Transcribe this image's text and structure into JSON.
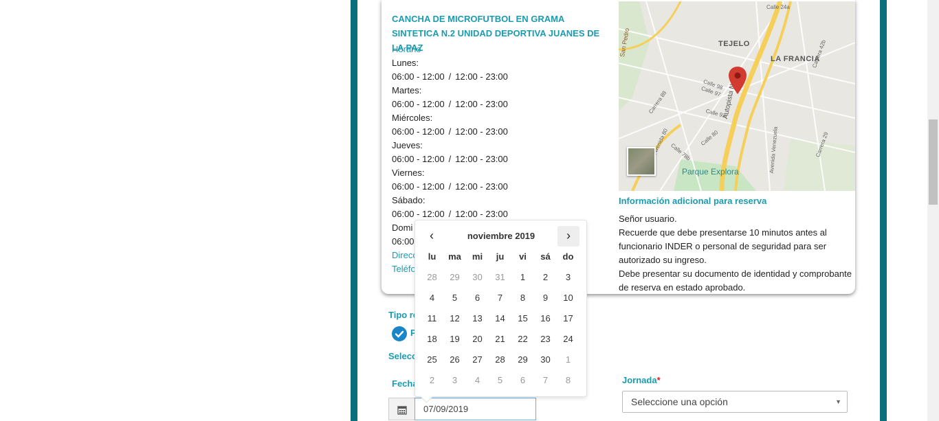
{
  "venue": {
    "title": "CANCHA DE MICROFUTBOL EN GRAMA SINTETICA N.2 UNIDAD DEPORTIVA JUANES DE LA PAZ",
    "schedule_label": "Horario",
    "schedule": [
      {
        "day": "Lunes:",
        "slot1": "06:00 - 12:00",
        "slot2": "12:00 - 23:00"
      },
      {
        "day": "Martes:",
        "slot1": "06:00 - 12:00",
        "slot2": "12:00 - 23:00"
      },
      {
        "day": "Miércoles:",
        "slot1": "06:00 - 12:00",
        "slot2": "12:00 - 23:00"
      },
      {
        "day": "Jueves:",
        "slot1": "06:00 - 12:00",
        "slot2": "12:00 - 23:00"
      },
      {
        "day": "Viernes:",
        "slot1": "06:00 - 12:00",
        "slot2": "12:00 - 23:00"
      },
      {
        "day": "Sábado:",
        "slot1": "06:00 - 12:00",
        "slot2": "12:00 - 23:00"
      },
      {
        "day": "Domi",
        "slot1": "06:00",
        "slot2": ""
      }
    ],
    "slot_separator": "/",
    "address_label": "Direcc",
    "phone_label": "Teléfo"
  },
  "map": {
    "labels": [
      "TEJELO",
      "LA FRANCIA",
      "Parque Explora",
      "Autopista Norte",
      "Calle 98",
      "Calle 97",
      "Calle 93",
      "Calle 80",
      "Calle 78b",
      "Carrera 88",
      "Avenida 80",
      "Avenida Venezuela",
      "Carrera 42b",
      "Carrera 29",
      "San Pedro",
      "Calle 24a"
    ]
  },
  "info": {
    "title": "Información adicional para reserva",
    "lines": [
      "Señor usuario.",
      "Recuerde que debe presentarse 10 minutos antes al",
      "funcionario INDER o personal de seguridad para ser",
      "autorizado su ingreso.",
      "Debe presentar su documento de identidad y comprobante",
      "de reserva en estado aprobado."
    ]
  },
  "form": {
    "tipo_label": "Tipo re",
    "option_label": "P",
    "select_label": "Selecc",
    "fecha_label": "Fecha",
    "date_value": "07/09/2019",
    "jornada_label": "Jornada",
    "required_mark": "*",
    "jornada_value": "Seleccione una opción"
  },
  "datepicker": {
    "month_title": "noviembre 2019",
    "prev": "‹",
    "next": "›",
    "weekdays": [
      "lu",
      "ma",
      "mi",
      "ju",
      "vi",
      "sá",
      "do"
    ],
    "weeks": [
      [
        "28",
        "29",
        "30",
        "31",
        "1",
        "2",
        "3"
      ],
      [
        "4",
        "5",
        "6",
        "7",
        "8",
        "9",
        "10"
      ],
      [
        "11",
        "12",
        "13",
        "14",
        "15",
        "16",
        "17"
      ],
      [
        "18",
        "19",
        "20",
        "21",
        "22",
        "23",
        "24"
      ],
      [
        "25",
        "26",
        "27",
        "28",
        "29",
        "30",
        "1"
      ],
      [
        "2",
        "3",
        "4",
        "5",
        "6",
        "7",
        "8"
      ]
    ],
    "outside": [
      [
        true,
        true,
        true,
        true,
        false,
        false,
        false
      ],
      [
        false,
        false,
        false,
        false,
        false,
        false,
        false
      ],
      [
        false,
        false,
        false,
        false,
        false,
        false,
        false
      ],
      [
        false,
        false,
        false,
        false,
        false,
        false,
        false
      ],
      [
        false,
        false,
        false,
        false,
        false,
        false,
        true
      ],
      [
        true,
        true,
        true,
        true,
        true,
        true,
        true
      ]
    ]
  },
  "colors": {
    "accent": "#1a9bb0",
    "frame": "#0b6f7c",
    "check": "#1a86c8",
    "pin": "#d23b2f"
  }
}
